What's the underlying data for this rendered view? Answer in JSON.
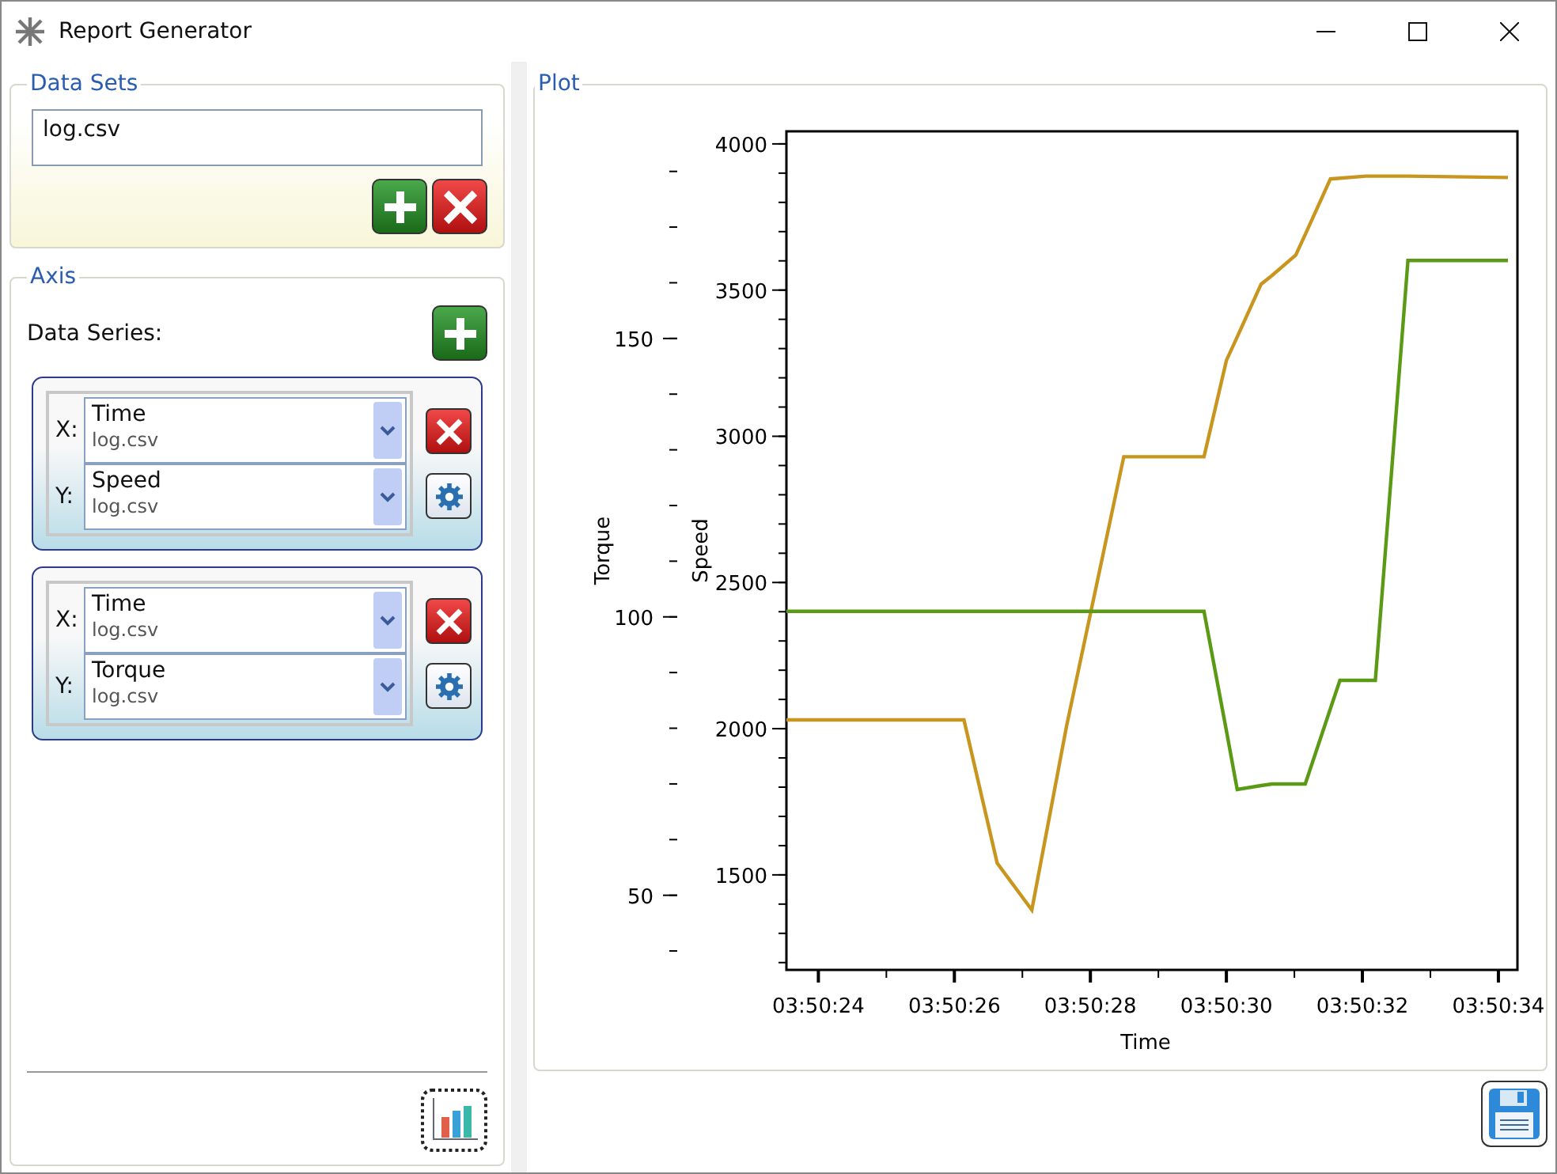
{
  "window": {
    "title": "Report Generator"
  },
  "data_sets": {
    "title": "Data Sets",
    "files": [
      "log.csv"
    ]
  },
  "axis": {
    "title": "Axis",
    "series_label": "Data Series:",
    "series": [
      {
        "x": {
          "label": "X:",
          "column": "Time",
          "file": "log.csv"
        },
        "y": {
          "label": "Y:",
          "column": "Speed",
          "file": "log.csv"
        }
      },
      {
        "x": {
          "label": "X:",
          "column": "Time",
          "file": "log.csv"
        },
        "y": {
          "label": "Y:",
          "column": "Torque",
          "file": "log.csv"
        }
      }
    ]
  },
  "plot": {
    "title": "Plot",
    "chart_data": {
      "type": "line",
      "xlabel": "Time",
      "ylabel": "Speed",
      "y2label": "Torque",
      "x": [
        13823.53,
        13826.14,
        13826.63,
        13827.14,
        13827.65,
        13828.49,
        13829.14,
        13829.67,
        13830.0,
        13830.16,
        13830.51,
        13830.67,
        13831.02,
        13831.16,
        13831.53,
        13831.67,
        13832.05,
        13832.19,
        13832.53,
        13832.67,
        13834.14
      ],
      "series": [
        {
          "color": "#c8961e",
          "axis": "y",
          "values": [
            2030,
            2030,
            1540,
            1380,
            2010,
            2930,
            2930,
            2930,
            3260,
            3340,
            3520,
            3550,
            3620,
            3690,
            3880,
            3883,
            3890,
            3890,
            3890,
            3890,
            3885
          ]
        },
        {
          "color": "#5a9a14",
          "axis": "y2",
          "values": [
            101,
            101,
            101,
            101,
            101,
            101,
            101,
            101,
            79.5,
            69,
            69.7,
            70,
            70,
            70,
            83.5,
            88.6,
            88.6,
            88.6,
            142,
            164,
            164
          ]
        }
      ],
      "xlim": [
        13823.53,
        13834.28
      ],
      "ylim": [
        1175,
        4043
      ],
      "y2lim": [
        36.6,
        187.2
      ],
      "xticks": [
        {
          "value": 13824,
          "label": "03:50:24"
        },
        {
          "value": 13826,
          "label": "03:50:26"
        },
        {
          "value": 13828,
          "label": "03:50:28"
        },
        {
          "value": 13830,
          "label": "03:50:30"
        },
        {
          "value": 13832,
          "label": "03:50:32"
        },
        {
          "value": 13834,
          "label": "03:50:34"
        }
      ],
      "yticks": [
        1500,
        2000,
        2500,
        3000,
        3500,
        4000
      ],
      "y2ticks": [
        50,
        100,
        150
      ]
    }
  }
}
